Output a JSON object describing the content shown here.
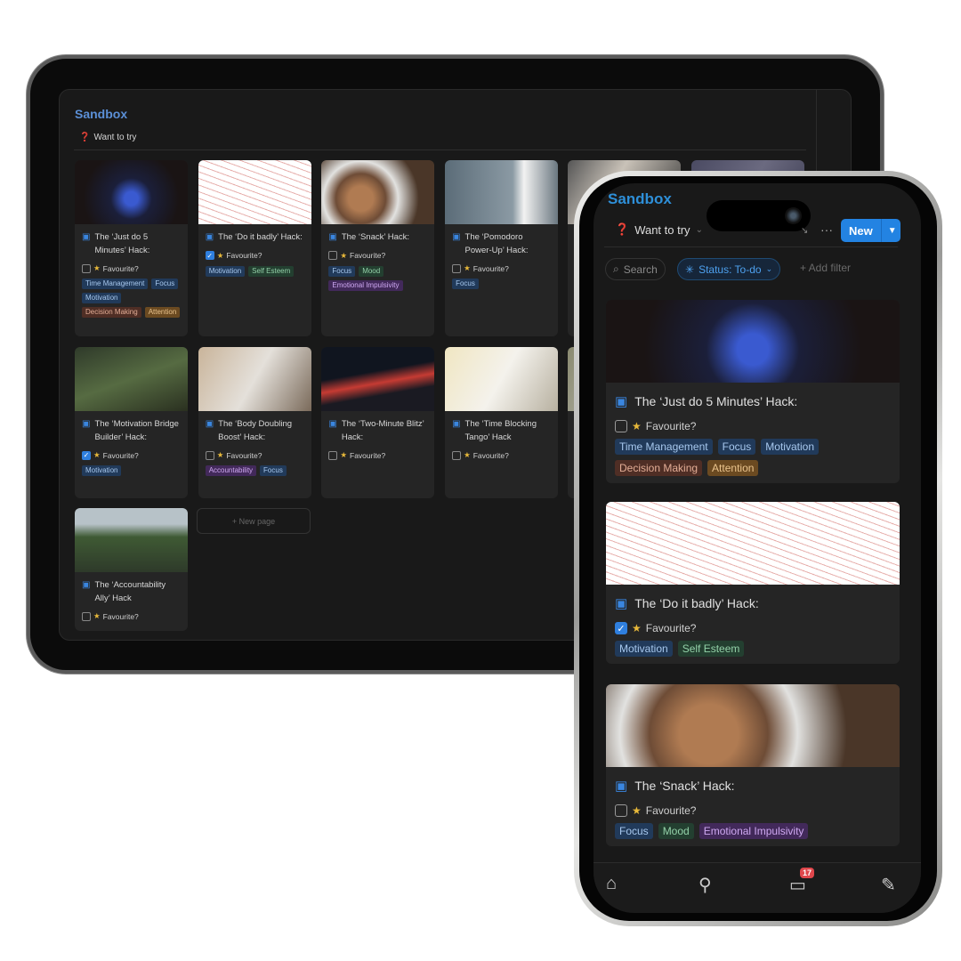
{
  "colors": {
    "accent": "#2383e2",
    "tag_blue": [
      "#213a5a",
      "#a7c8ee"
    ],
    "tag_green": [
      "#233f30",
      "#94d2a9"
    ],
    "tag_purple": [
      "#42295a",
      "#cfa9f2"
    ],
    "tag_brown": [
      "#4f2e25",
      "#e3ad96"
    ],
    "tag_orange": [
      "#6b4a21",
      "#eac48d"
    ]
  },
  "tablet": {
    "title": "Sandbox",
    "view": "Want to try",
    "new_page": "+ New page"
  },
  "phone": {
    "title": "Sandbox",
    "view": "Want to try",
    "more": "···",
    "new_label": "New",
    "search": "Search",
    "status_filter": "Status: To-do",
    "add_filter": "+ Add filter",
    "inbox_badge": "17"
  },
  "fav_label": "Favourite?",
  "cards": [
    {
      "title": "The ‘Just do 5 Minutes’ Hack:",
      "favourite": false,
      "tags": [
        {
          "label": "Time Management",
          "color": "blue"
        },
        {
          "label": "Focus",
          "color": "blue"
        },
        {
          "label": "Motivation",
          "color": "blue"
        },
        {
          "label": "Decision Making",
          "color": "brown"
        },
        {
          "label": "Attention",
          "color": "orange"
        }
      ]
    },
    {
      "title": "The ‘Do it badly’ Hack:",
      "favourite": true,
      "tags": [
        {
          "label": "Motivation",
          "color": "blue"
        },
        {
          "label": "Self Esteem",
          "color": "green"
        }
      ]
    },
    {
      "title": "The ‘Snack’ Hack:",
      "favourite": false,
      "tags": [
        {
          "label": "Focus",
          "color": "blue"
        },
        {
          "label": "Mood",
          "color": "green"
        },
        {
          "label": "Emotional Impulsivity",
          "color": "purple"
        }
      ]
    },
    {
      "title": "The ‘Pomodoro Power-Up’ Hack:",
      "favourite": false,
      "tags": [
        {
          "label": "Focus",
          "color": "blue"
        }
      ]
    },
    {
      "title": "The ‘Motivation Bridge Builder’ Hack:",
      "favourite": true,
      "tags": [
        {
          "label": "Motivation",
          "color": "blue"
        }
      ]
    },
    {
      "title": "The ‘Body Doubling Boost’ Hack:",
      "favourite": false,
      "tags": [
        {
          "label": "Accountability",
          "color": "purple"
        },
        {
          "label": "Focus",
          "color": "blue"
        }
      ]
    },
    {
      "title": "The ‘Two-Minute Blitz’ Hack:",
      "favourite": false,
      "tags": []
    },
    {
      "title": "The ‘Time Blocking Tango’ Hack",
      "favourite": false,
      "tags": []
    },
    {
      "title": "The ‘Accountability Ally’ Hack",
      "favourite": false,
      "tags": []
    }
  ]
}
